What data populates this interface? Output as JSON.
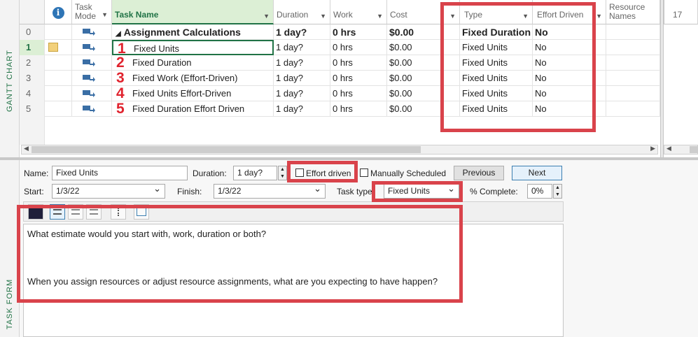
{
  "side_labels": {
    "gantt": "GANTT CHART",
    "task_form": "TASK FORM"
  },
  "columns": {
    "info_icon": "i",
    "mode": "Task Mode",
    "name": "Task Name",
    "duration": "Duration",
    "work": "Work",
    "cost": "Cost",
    "type": "Type",
    "effort": "Effort Driven",
    "resource": "Resource Names",
    "timeline": "17"
  },
  "rows": [
    {
      "id": "0",
      "name": "Assignment Calculations",
      "duration": "1 day?",
      "work": "0 hrs",
      "cost": "$0.00",
      "type": "Fixed Duration",
      "effort": "No",
      "summary": true,
      "marker": "◢"
    },
    {
      "id": "1",
      "number": "1",
      "name": "Fixed Units",
      "duration": "1 day?",
      "work": "0 hrs",
      "cost": "$0.00",
      "type": "Fixed Units",
      "effort": "No"
    },
    {
      "id": "2",
      "number": "2",
      "name": "Fixed Duration",
      "duration": "1 day?",
      "work": "0 hrs",
      "cost": "$0.00",
      "type": "Fixed Units",
      "effort": "No"
    },
    {
      "id": "3",
      "number": "3",
      "name": "Fixed Work (Effort-Driven)",
      "duration": "1 day?",
      "work": "0 hrs",
      "cost": "$0.00",
      "type": "Fixed Units",
      "effort": "No"
    },
    {
      "id": "4",
      "number": "4",
      "name": "Fixed Units Effort-Driven",
      "duration": "1 day?",
      "work": "0 hrs",
      "cost": "$0.00",
      "type": "Fixed Units",
      "effort": "No"
    },
    {
      "id": "5",
      "number": "5",
      "name": "Fixed Duration Effort Driven",
      "duration": "1 day?",
      "work": "0 hrs",
      "cost": "$0.00",
      "type": "Fixed Units",
      "effort": "No"
    }
  ],
  "form": {
    "name_label": "Name:",
    "name_value": "Fixed Units",
    "duration_label": "Duration:",
    "duration_value": "1 day?",
    "effort_label": "Effort driven",
    "manual_label": "Manually Scheduled",
    "previous": "Previous",
    "next": "Next",
    "start_label": "Start:",
    "start_value": "1/3/22",
    "finish_label": "Finish:",
    "finish_value": "1/3/22",
    "task_type_label": "Task type:",
    "task_type_value": "Fixed Units",
    "complete_label": "% Complete:",
    "complete_value": "0%",
    "note1": "What estimate would you start with, work, duration or both?",
    "note2": "When you assign resources or adjust resource assignments, what are you expecting to have happen?"
  },
  "colors": {
    "highlight": "#d9434b",
    "accent": "#217346",
    "red_numbers": "#e0232e"
  }
}
